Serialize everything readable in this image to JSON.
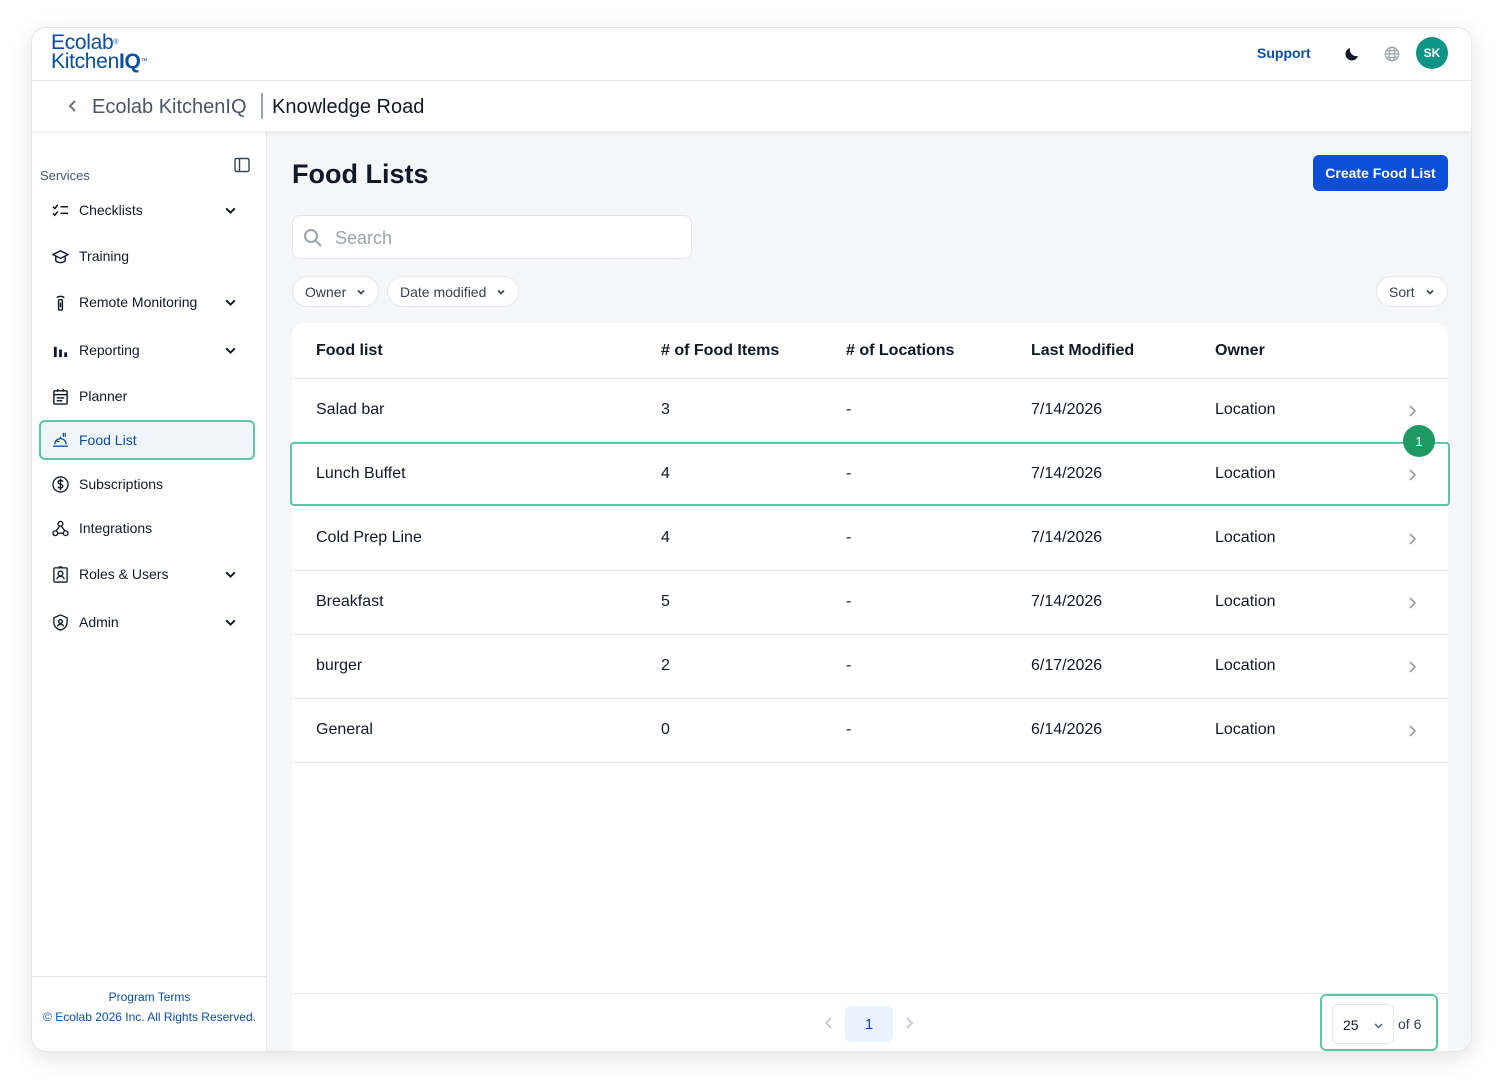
{
  "header": {
    "brand_line1": "Ecolab",
    "brand_line2a": "Kitchen",
    "brand_line2b": "IQ",
    "support_label": "Support",
    "avatar_initials": "SK",
    "org_name": "Ecolab KitchenIQ",
    "site_name": "Knowledge Road"
  },
  "sidebar": {
    "section_label": "Services",
    "items": [
      {
        "label": "Checklists",
        "icon": "checklist-icon",
        "expandable": true
      },
      {
        "label": "Training",
        "icon": "graduation-cap-icon",
        "expandable": false
      },
      {
        "label": "Remote Monitoring",
        "icon": "thermometer-icon",
        "expandable": true
      },
      {
        "label": "Reporting",
        "icon": "bar-chart-icon",
        "expandable": true
      },
      {
        "label": "Planner",
        "icon": "calendar-icon",
        "expandable": false
      },
      {
        "label": "Food List",
        "icon": "food-tray-icon",
        "expandable": false,
        "active": true
      },
      {
        "label": "Subscriptions",
        "icon": "dollar-circle-icon",
        "expandable": false
      },
      {
        "label": "Integrations",
        "icon": "integrations-icon",
        "expandable": false
      },
      {
        "label": "Roles & Users",
        "icon": "id-badge-icon",
        "expandable": true
      },
      {
        "label": "Admin",
        "icon": "shield-icon",
        "expandable": true
      }
    ],
    "footer": {
      "terms": "Program Terms",
      "copyright": "© Ecolab 2026 Inc. All Rights Reserved."
    }
  },
  "main": {
    "title": "Food Lists",
    "create_button": "Create Food List",
    "search_placeholder": "Search",
    "filters": {
      "owner": "Owner",
      "date_modified": "Date modified",
      "sort": "Sort"
    },
    "columns": [
      "Food list",
      "# of Food Items",
      "# of Locations",
      "Last Modified",
      "Owner"
    ],
    "rows": [
      {
        "name": "Salad bar",
        "items": "3",
        "locations": "-",
        "modified": "7/14/2026",
        "owner": "Location"
      },
      {
        "name": "Lunch Buffet",
        "items": "4",
        "locations": "-",
        "modified": "7/14/2026",
        "owner": "Location"
      },
      {
        "name": "Cold Prep Line",
        "items": "4",
        "locations": "-",
        "modified": "7/14/2026",
        "owner": "Location"
      },
      {
        "name": "Breakfast",
        "items": "5",
        "locations": "-",
        "modified": "7/14/2026",
        "owner": "Location"
      },
      {
        "name": "burger",
        "items": "2",
        "locations": "-",
        "modified": "6/17/2026",
        "owner": "Location"
      },
      {
        "name": "General",
        "items": "0",
        "locations": "-",
        "modified": "6/14/2026",
        "owner": "Location"
      }
    ],
    "highlight_badge": "1",
    "pagination": {
      "current_page": "1",
      "per_page": "25",
      "total_label": "of 6"
    }
  },
  "colors": {
    "brand": "#0b4ea2",
    "primary_button": "#0b4ed8",
    "highlight": "#5ec5a6",
    "badge": "#1d9a63",
    "avatar": "#0f9488"
  }
}
